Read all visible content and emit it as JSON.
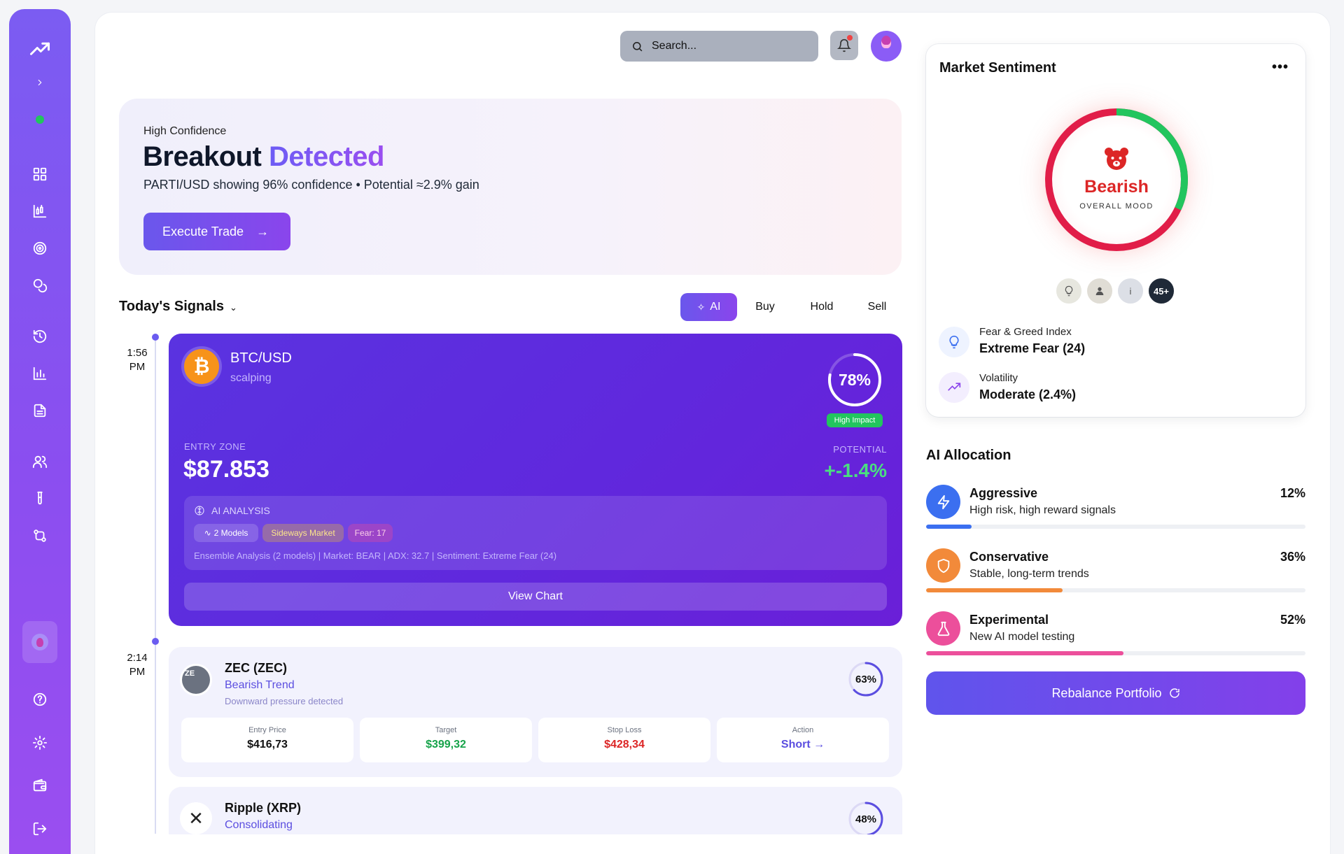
{
  "search": {
    "placeholder": "Search..."
  },
  "hero": {
    "confidence_label": "High Confidence",
    "title_main": "Breakout",
    "title_accent": "Detected",
    "subtitle": "PARTI/USD showing 96% confidence • Potential ≈2.9% gain",
    "button_label": "Execute Trade",
    "button_arrow": "→"
  },
  "signals": {
    "title": "Today's Signals",
    "chevron": "⌄",
    "tabs": {
      "ai": "AI",
      "buy": "Buy",
      "hold": "Hold",
      "sell": "Sell"
    },
    "btc": {
      "time": "1:56",
      "ampm": "PM",
      "pair": "BTC/USD",
      "strategy": "scalping",
      "logo_symbol": "₿",
      "confidence": "78%",
      "confidence_fraction": 0.78,
      "impact": "High Impact",
      "entry_label": "ENTRY ZONE",
      "entry_value": "$87.853",
      "potential_label": "POTENTIAL",
      "potential_value": "+-1.4%",
      "analysis_title": "AI ANALYSIS",
      "pill_models": "2 Models",
      "pill_market": "Sideways Market",
      "pill_fear": "Fear: 17",
      "analysis_text": "Ensemble Analysis (2 models) | Market: BEAR | ADX: 32.7 | Sentiment: Extreme Fear (24)",
      "view_chart": "View Chart"
    },
    "zec": {
      "time": "2:14",
      "ampm": "PM",
      "logo_text": "ZE",
      "name": "ZEC (ZEC)",
      "trend": "Bearish Trend",
      "desc": "Downward pressure detected",
      "confidence": "63%",
      "confidence_fraction": 0.63,
      "entry_label": "Entry Price",
      "entry_value": "$416,73",
      "target_label": "Target",
      "target_value": "$399,32",
      "stop_label": "Stop Loss",
      "stop_value": "$428,34",
      "action_label": "Action",
      "action_value": "Short →"
    },
    "xrp": {
      "name": "Ripple (XRP)",
      "trend": "Consolidating",
      "logo_symbol": "✕",
      "confidence": "48%",
      "confidence_fraction": 0.48
    }
  },
  "sentiment": {
    "title": "Market Sentiment",
    "menu": "•••",
    "mood": "Bearish",
    "mood_sub": "OVERALL MOOD",
    "bullish_fraction": 0.32,
    "chip_info": "i",
    "chip_count": "45+",
    "fear_greed_label": "Fear & Greed Index",
    "fear_greed_value": "Extreme Fear (24)",
    "volatility_label": "Volatility",
    "volatility_value": "Moderate (2.4%)"
  },
  "allocation": {
    "title": "AI Allocation",
    "items": [
      {
        "name": "Aggressive",
        "desc": "High risk, high reward signals",
        "pct": "12%",
        "value": 12,
        "color": "#3b6ff0"
      },
      {
        "name": "Conservative",
        "desc": "Stable, long-term trends",
        "pct": "36%",
        "value": 36,
        "color": "#f28a3a"
      },
      {
        "name": "Experimental",
        "desc": "New AI model testing",
        "pct": "52%",
        "value": 52,
        "color": "#ec4f9b"
      }
    ],
    "rebalance_label": "Rebalance Portfolio"
  },
  "colors": {
    "accent": "#6a57ec",
    "bearish": "#dc2626",
    "bullish": "#22c55e",
    "btc_card": "#5a33e0"
  }
}
